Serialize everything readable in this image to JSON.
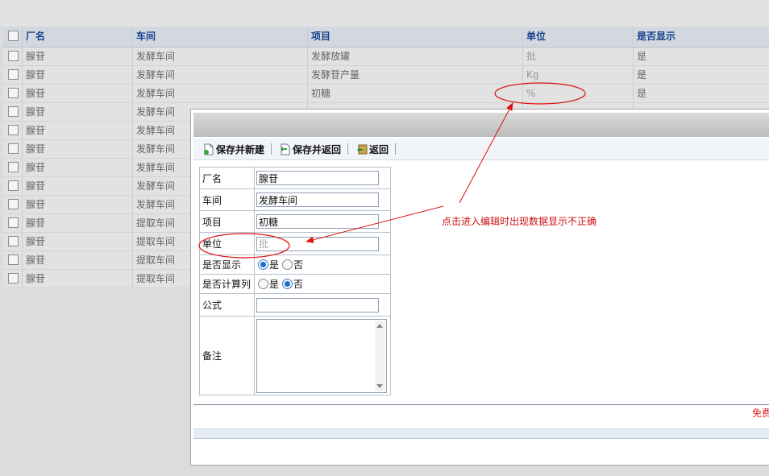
{
  "grid": {
    "headers": [
      "厂名",
      "车间",
      "项目",
      "单位",
      "是否显示"
    ],
    "rows": [
      {
        "factory": "腺苷",
        "workshop": "发酵车间",
        "item": "发酵放罐",
        "unit": "批",
        "display": "是"
      },
      {
        "factory": "腺苷",
        "workshop": "发酵车间",
        "item": "发酵苷产量",
        "unit": "Kg",
        "display": "是"
      },
      {
        "factory": "腺苷",
        "workshop": "发酵车间",
        "item": "初糖",
        "unit": "%",
        "display": "是"
      },
      {
        "factory": "腺苷",
        "workshop": "发酵车间",
        "item": "",
        "unit": "",
        "display": ""
      },
      {
        "factory": "腺苷",
        "workshop": "发酵车间",
        "item": "",
        "unit": "",
        "display": ""
      },
      {
        "factory": "腺苷",
        "workshop": "发酵车间",
        "item": "",
        "unit": "",
        "display": ""
      },
      {
        "factory": "腺苷",
        "workshop": "发酵车间",
        "item": "",
        "unit": "",
        "display": ""
      },
      {
        "factory": "腺苷",
        "workshop": "发酵车间",
        "item": "",
        "unit": "",
        "display": ""
      },
      {
        "factory": "腺苷",
        "workshop": "发酵车间",
        "item": "",
        "unit": "",
        "display": ""
      },
      {
        "factory": "腺苷",
        "workshop": "提取车间",
        "item": "",
        "unit": "",
        "display": ""
      },
      {
        "factory": "腺苷",
        "workshop": "提取车间",
        "item": "",
        "unit": "",
        "display": ""
      },
      {
        "factory": "腺苷",
        "workshop": "提取车间",
        "item": "",
        "unit": "",
        "display": ""
      },
      {
        "factory": "腺苷",
        "workshop": "提取车间",
        "item": "",
        "unit": "",
        "display": ""
      }
    ]
  },
  "dialog": {
    "toolbar": {
      "save_new": "保存并新建",
      "save_back": "保存并返回",
      "back": "返回"
    },
    "form": {
      "factory_label": "厂名",
      "factory_value": "腺苷",
      "workshop_label": "车间",
      "workshop_value": "发酵车间",
      "item_label": "项目",
      "item_value": "初糖",
      "unit_label": "单位",
      "unit_value": "批",
      "display_label": "是否显示",
      "display_yes": "是",
      "display_no": "否",
      "calc_label": "是否计算列",
      "calc_yes": "是",
      "calc_no": "否",
      "formula_label": "公式",
      "formula_value": "",
      "remark_label": "备注"
    },
    "footer_text": "免费"
  },
  "annotation": {
    "note": "点击进入编辑时出现数据显示不正确",
    "color": "#cc1111"
  }
}
